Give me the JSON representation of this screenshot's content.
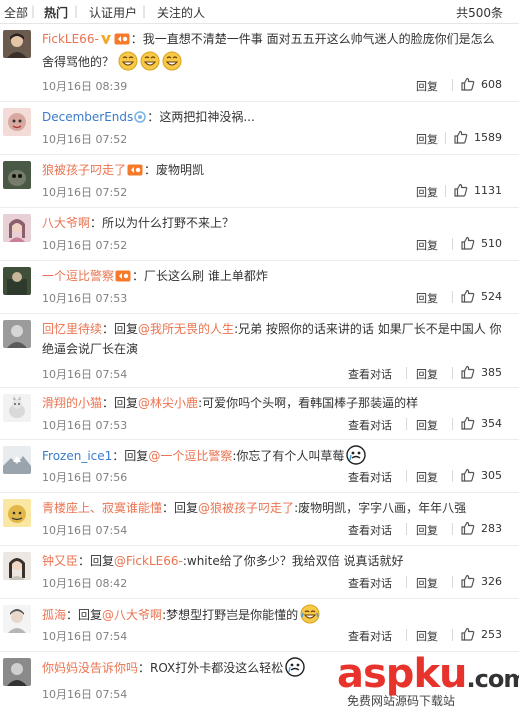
{
  "tabs": {
    "all": "全部",
    "hot": "热门",
    "verified": "认证用户",
    "following": "关注的人",
    "total": "共500条"
  },
  "ui": {
    "reply_label": "回复",
    "view_conversation_label": "查看对话",
    "reply_prefix": "回复",
    "colon": "：",
    "colon_half": ":"
  },
  "comments": [
    {
      "user": "FickLE66-",
      "text": "我一直想不清楚一件事 面对五五开这么帅气迷人的脸庞你们是怎么",
      "text2": "舍得骂他的？",
      "time": "10月16日 08:39",
      "likes": "608",
      "avatar_color": "#6b5a4e",
      "has_view_conversation": false
    },
    {
      "user": "DecemberEnds",
      "text": "这两把扣神没祸...",
      "time": "10月16日 07:52",
      "likes": "1589",
      "avatar_color": "#d8a9a0",
      "has_view_conversation": false
    },
    {
      "user": "狼被孩子叼走了",
      "text": "废物明凯",
      "time": "10月16日 07:52",
      "likes": "1131",
      "avatar_color": "#4a5846",
      "has_view_conversation": false
    },
    {
      "user": "八大爷啊",
      "text": "所以为什么打野不来上？",
      "time": "10月16日 07:52",
      "likes": "510",
      "avatar_color": "#8b5f6c",
      "has_view_conversation": false
    },
    {
      "user": "一个逗比警察",
      "text": "厂长这么刷 谁上单都炸",
      "time": "10月16日 07:53",
      "likes": "524",
      "avatar_color": "#3f4f3a",
      "has_view_conversation": false
    },
    {
      "user": "回忆里待续",
      "mention": "@我所无畏的人生",
      "text": "兄弟 按照你的话来讲的话 如果厂长不是中国人 你",
      "text2": "绝逼会说厂长在演",
      "time": "10月16日 07:54",
      "likes": "385",
      "avatar_color": "#7a7a7a",
      "has_view_conversation": true
    },
    {
      "user": "滑翔的小猫",
      "mention": "@林尖小鹿",
      "text": "可爱你吗个头啊，看韩国棒子那装逼的样",
      "time": "10月16日 07:53",
      "likes": "354",
      "avatar_color": "#d9d9d9",
      "has_view_conversation": true
    },
    {
      "user": "Frozen_ice1",
      "mention": "@一个逗比警察",
      "text": "你忘了有个人叫草莓",
      "time": "10月16日 07:56",
      "likes": "305",
      "avatar_color": "#c8cdd4",
      "has_view_conversation": true
    },
    {
      "user": "青楼座上、寂寞谁能懂",
      "mention": "@狼被孩子叼走了",
      "text": "废物明凯，字字八画，年年八强",
      "time": "10月16日 07:54",
      "likes": "283",
      "avatar_color": "#e2b84a",
      "has_view_conversation": true
    },
    {
      "user": "钟又臣",
      "mention": "@FickLE66-",
      "text": "white给了你多少？我给双倍 说真话就好",
      "time": "10月16日 08:42",
      "likes": "326",
      "avatar_color": "#c9c3bd",
      "has_view_conversation": true
    },
    {
      "user": "孤海",
      "mention": "@八大爷啊",
      "text": "梦想型打野岂是你能懂的",
      "time": "10月16日 07:54",
      "likes": "253",
      "avatar_color": "#b6b6b6",
      "has_view_conversation": true
    },
    {
      "user": "你妈妈没告诉你吗",
      "text": "ROX打外卡都没这么轻松",
      "time": "10月16日 07:54",
      "avatar_color": "#8a8a8a",
      "has_view_conversation": false
    }
  ],
  "watermark": {
    "text_a": "asp",
    "text_b": "ku",
    "text_c": ".com",
    "sub": "免费网站源码下载站",
    "color_a": "#e8332d",
    "color_b": "#e8332d"
  },
  "colors": {
    "username": "#eb7350",
    "username_blue": "#3b7acb",
    "mention": "#eb7350",
    "time": "#808080"
  }
}
